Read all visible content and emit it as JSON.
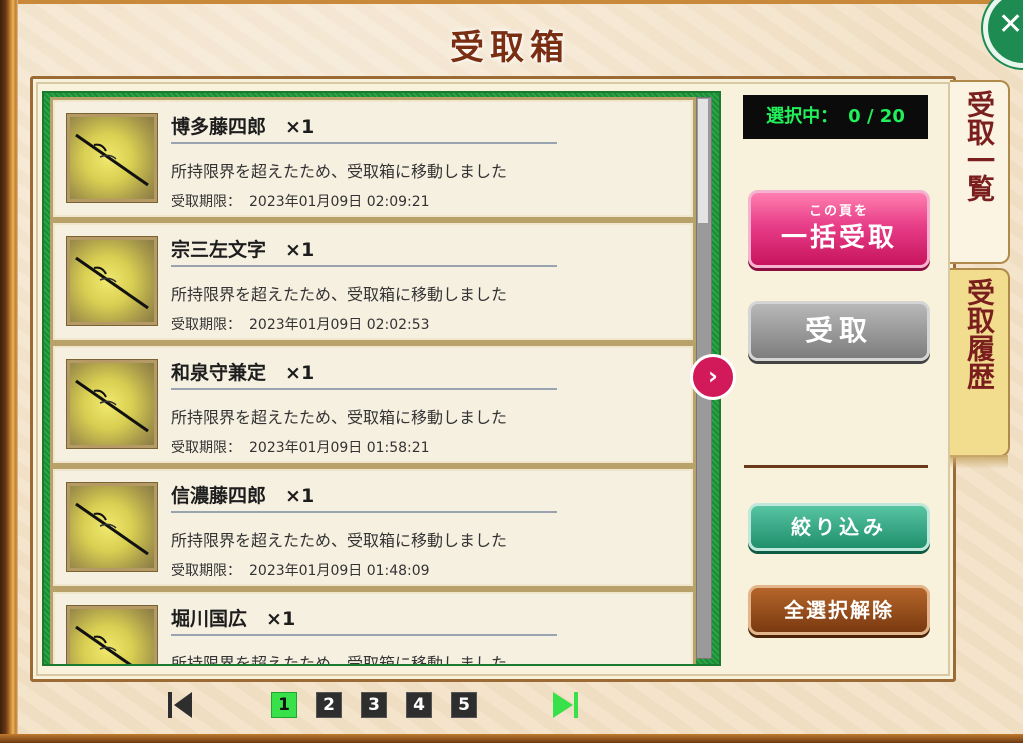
{
  "screen": {
    "title": "受取箱"
  },
  "list": {
    "items": [
      {
        "name": "博多藤四郎",
        "qty": "×1",
        "message": "所持限界を超えたため、受取箱に移動しました",
        "expiry_label": "受取期限：",
        "expiry": "2023年01月09日 02:09:21"
      },
      {
        "name": "宗三左文字",
        "qty": "×1",
        "message": "所持限界を超えたため、受取箱に移動しました",
        "expiry_label": "受取期限：",
        "expiry": "2023年01月09日 02:02:53"
      },
      {
        "name": "和泉守兼定",
        "qty": "×1",
        "message": "所持限界を超えたため、受取箱に移動しました",
        "expiry_label": "受取期限：",
        "expiry": "2023年01月09日 01:58:21"
      },
      {
        "name": "信濃藤四郎",
        "qty": "×1",
        "message": "所持限界を超えたため、受取箱に移動しました",
        "expiry_label": "受取期限：",
        "expiry": "2023年01月09日 01:48:09"
      },
      {
        "name": "堀川国広",
        "qty": "×1",
        "message": "所持限界を超えたため、受取箱に移動しました",
        "expiry_label": "",
        "expiry": ""
      }
    ],
    "scroll_fraction": 0.22
  },
  "selection": {
    "label": "選択中：",
    "value": "0 / 20"
  },
  "buttons": {
    "bulk_small": "この頁を",
    "bulk_big": "一括受取",
    "receive": "受取",
    "filter": "絞り込み",
    "deselect_all": "全選択解除"
  },
  "tabs": [
    {
      "label": "受取一覧",
      "active": true
    },
    {
      "label": "受取履歴",
      "active": false
    }
  ],
  "pagination": {
    "pages": [
      "1",
      "2",
      "3",
      "4",
      "5"
    ],
    "current": "1"
  },
  "colors": {
    "accent_pink": "#e83d88",
    "list_green": "#1f8f3a",
    "counter_green": "#21f05a",
    "page_current": "#38e04a"
  },
  "icons": [
    "close-icon",
    "chevron-right-icon",
    "first-page-icon",
    "last-page-icon",
    "katana-icon"
  ]
}
